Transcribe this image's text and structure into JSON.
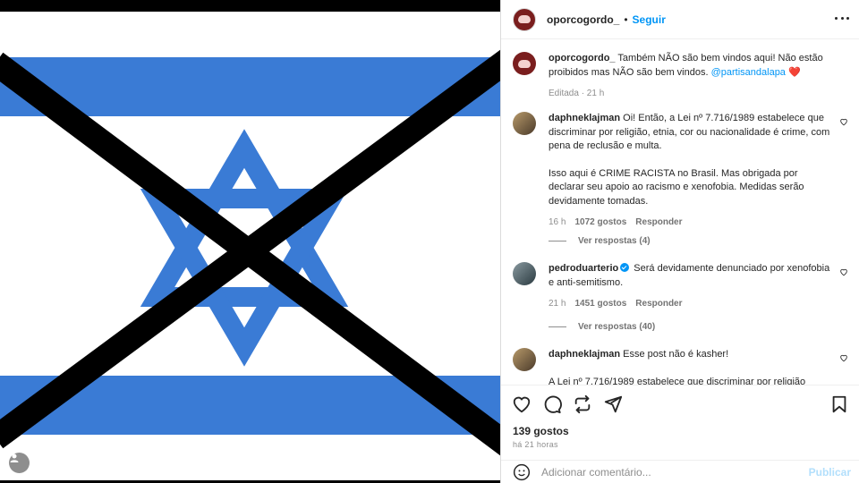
{
  "post": {
    "username": "oporcogordo_",
    "follow_label": "Seguir",
    "separator": "•"
  },
  "caption": {
    "username": "oporcogordo_",
    "text": "Também NÃO são bem vindos aqui! Não estão proibidos mas NÃO são bem vindos.",
    "mention": "@partisandalapa",
    "emoji": "❤️",
    "meta": "Editada · 21 h"
  },
  "comments": [
    {
      "username": "daphneklajman",
      "text": "Oi! Então, a Lei nº 7.716/1989 estabelece que discriminar por religião, etnia, cor ou nacionalidade é crime, com pena de reclusão e multa.",
      "text2": "Isso aqui é CRIME RACISTA no Brasil. Mas obrigada por declarar seu apoio ao racismo e xenofobia. Medidas serão devidamente tomadas.",
      "time": "16 h",
      "likes": "1072 gostos",
      "reply": "Responder",
      "view_replies": "Ver respostas (4)"
    },
    {
      "username": "pedroduarterio",
      "text": "Será devidamente denunciado por xenofobia e anti-semitismo.",
      "time": "21 h",
      "likes": "1451 gostos",
      "reply": "Responder",
      "view_replies": "Ver respostas (40)"
    },
    {
      "username": "daphneklajman",
      "text": "Esse post não é kasher!",
      "text2": "A Lei nº 7.716/1989 estabelece que discriminar por religião"
    }
  ],
  "footer": {
    "likes": "139 gostos",
    "time_ago": "há 21 horas",
    "comment_placeholder": "Adicionar comentário...",
    "publish_label": "Publicar"
  },
  "colors": {
    "flag_blue": "#3a7bd5",
    "link_blue": "#0095f6",
    "cross": "#000000"
  }
}
